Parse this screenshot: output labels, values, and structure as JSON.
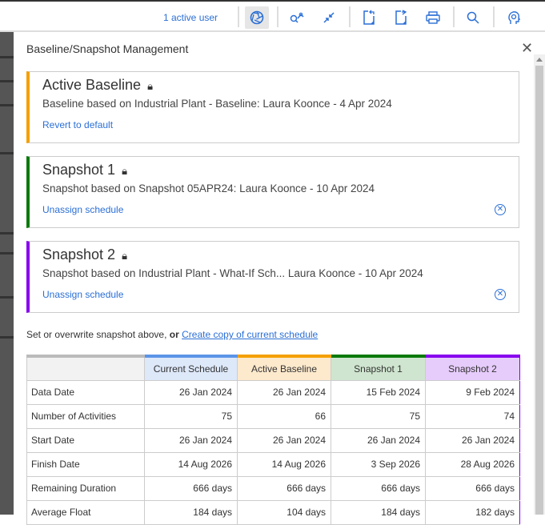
{
  "toolbar": {
    "active_users": "1 active user",
    "icons": [
      "baseline-snapshot-icon",
      "trace-logic-icon",
      "collapse-icon",
      "import-icon",
      "export-icon",
      "print-icon",
      "search-icon",
      "ai-assistant-icon"
    ]
  },
  "panel": {
    "title": "Baseline/Snapshot Management"
  },
  "cards": [
    {
      "title": "Active Baseline",
      "desc": "Baseline based on Industrial Plant - Baseline: Laura Koonce - 4 Apr 2024",
      "link": "Revert to default",
      "color": "#f5a000"
    },
    {
      "title": "Snapshot 1",
      "desc": "Snapshot based on Snapshot 05APR24: Laura Koonce - 10 Apr 2024",
      "link": "Unassign schedule",
      "color": "#0a7a0a"
    },
    {
      "title": "Snapshot 2",
      "desc": "Snapshot based on Industrial Plant - What-If Sch...  Laura Koonce - 10 Apr 2024",
      "link": "Unassign schedule",
      "color": "#8800ee"
    }
  ],
  "note": {
    "text": "Set or overwrite snapshot above,",
    "bold": "or",
    "link": "Create copy of current schedule"
  },
  "table": {
    "headers": [
      "Current Schedule",
      "Active Baseline",
      "Snapshot 1",
      "Snapshot 2"
    ],
    "rows": [
      {
        "label": "Data Date",
        "values": [
          "26 Jan 2024",
          "26 Jan 2024",
          "15 Feb 2024",
          "9 Feb 2024"
        ]
      },
      {
        "label": "Number of Activities",
        "values": [
          "75",
          "66",
          "75",
          "74"
        ]
      },
      {
        "label": "Start Date",
        "values": [
          "26 Jan 2024",
          "26 Jan 2024",
          "26 Jan 2024",
          "26 Jan 2024"
        ]
      },
      {
        "label": "Finish Date",
        "values": [
          "14 Aug 2026",
          "14 Aug 2026",
          "3 Sep 2026",
          "28 Aug 2026"
        ]
      },
      {
        "label": "Remaining Duration",
        "values": [
          "666 days",
          "666 days",
          "666 days",
          "666 days"
        ]
      },
      {
        "label": "Average Float",
        "values": [
          "184 days",
          "104 days",
          "184 days",
          "182 days"
        ]
      }
    ]
  }
}
